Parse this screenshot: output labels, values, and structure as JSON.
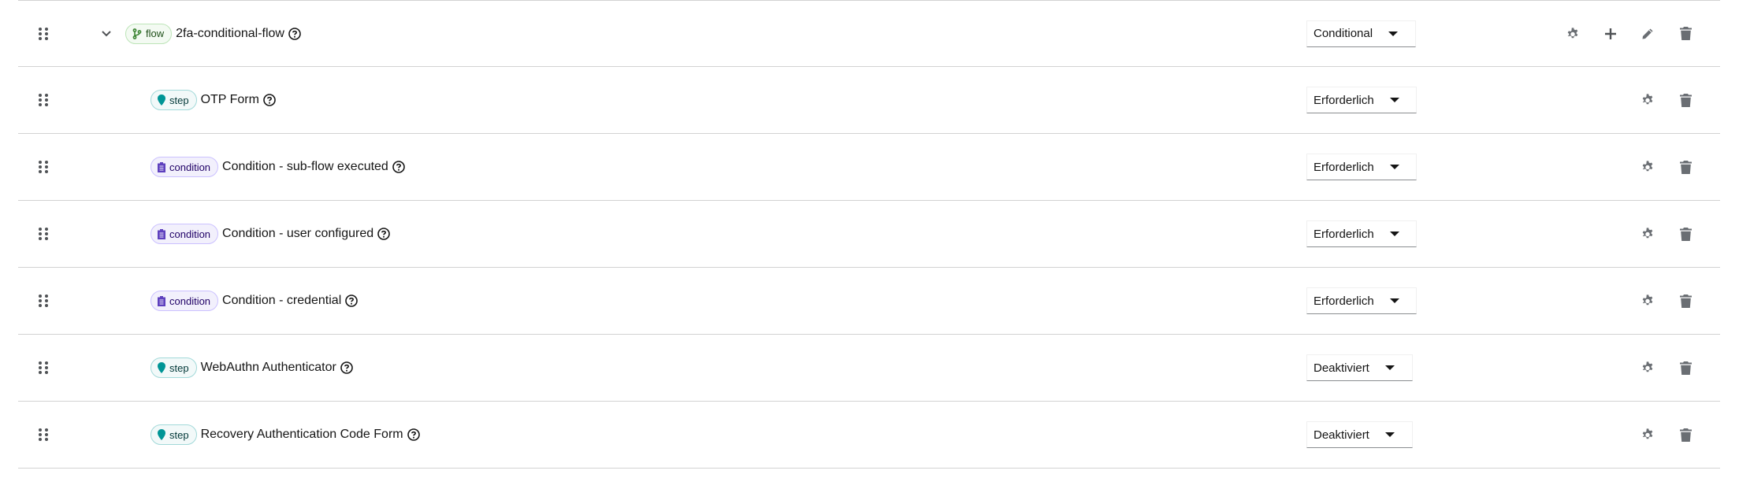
{
  "flow_row": {
    "badge": "flow",
    "title": "2fa-conditional-flow",
    "requirement": "Conditional"
  },
  "executions": [
    {
      "badge": "step",
      "title": "OTP Form",
      "requirement": "Erforderlich"
    },
    {
      "badge": "condition",
      "title": "Condition - sub-flow executed",
      "requirement": "Erforderlich"
    },
    {
      "badge": "condition",
      "title": "Condition - user configured",
      "requirement": "Erforderlich"
    },
    {
      "badge": "condition",
      "title": "Condition - credential",
      "requirement": "Erforderlich"
    },
    {
      "badge": "step",
      "title": "WebAuthn Authenticator",
      "requirement": "Deaktiviert"
    },
    {
      "badge": "step",
      "title": "Recovery Authentication Code Form",
      "requirement": "Deaktiviert"
    }
  ],
  "icons": {
    "drag": "grip-vertical-icon",
    "toggle": "chevron-down-icon",
    "help": "question-circle-icon",
    "settings": "gear-icon",
    "add": "plus-icon",
    "edit": "pencil-icon",
    "delete": "trash-icon",
    "flow": "code-branch-icon",
    "step": "map-marker-icon",
    "condition": "clipboard-icon"
  },
  "colors": {
    "flow_label_bg": "#f3faf2",
    "step_label_bg": "#f2f9f9",
    "condition_label_bg": "#f2f0fc",
    "icon_gray": "#6a6e73",
    "border": "#d2d2d2"
  }
}
